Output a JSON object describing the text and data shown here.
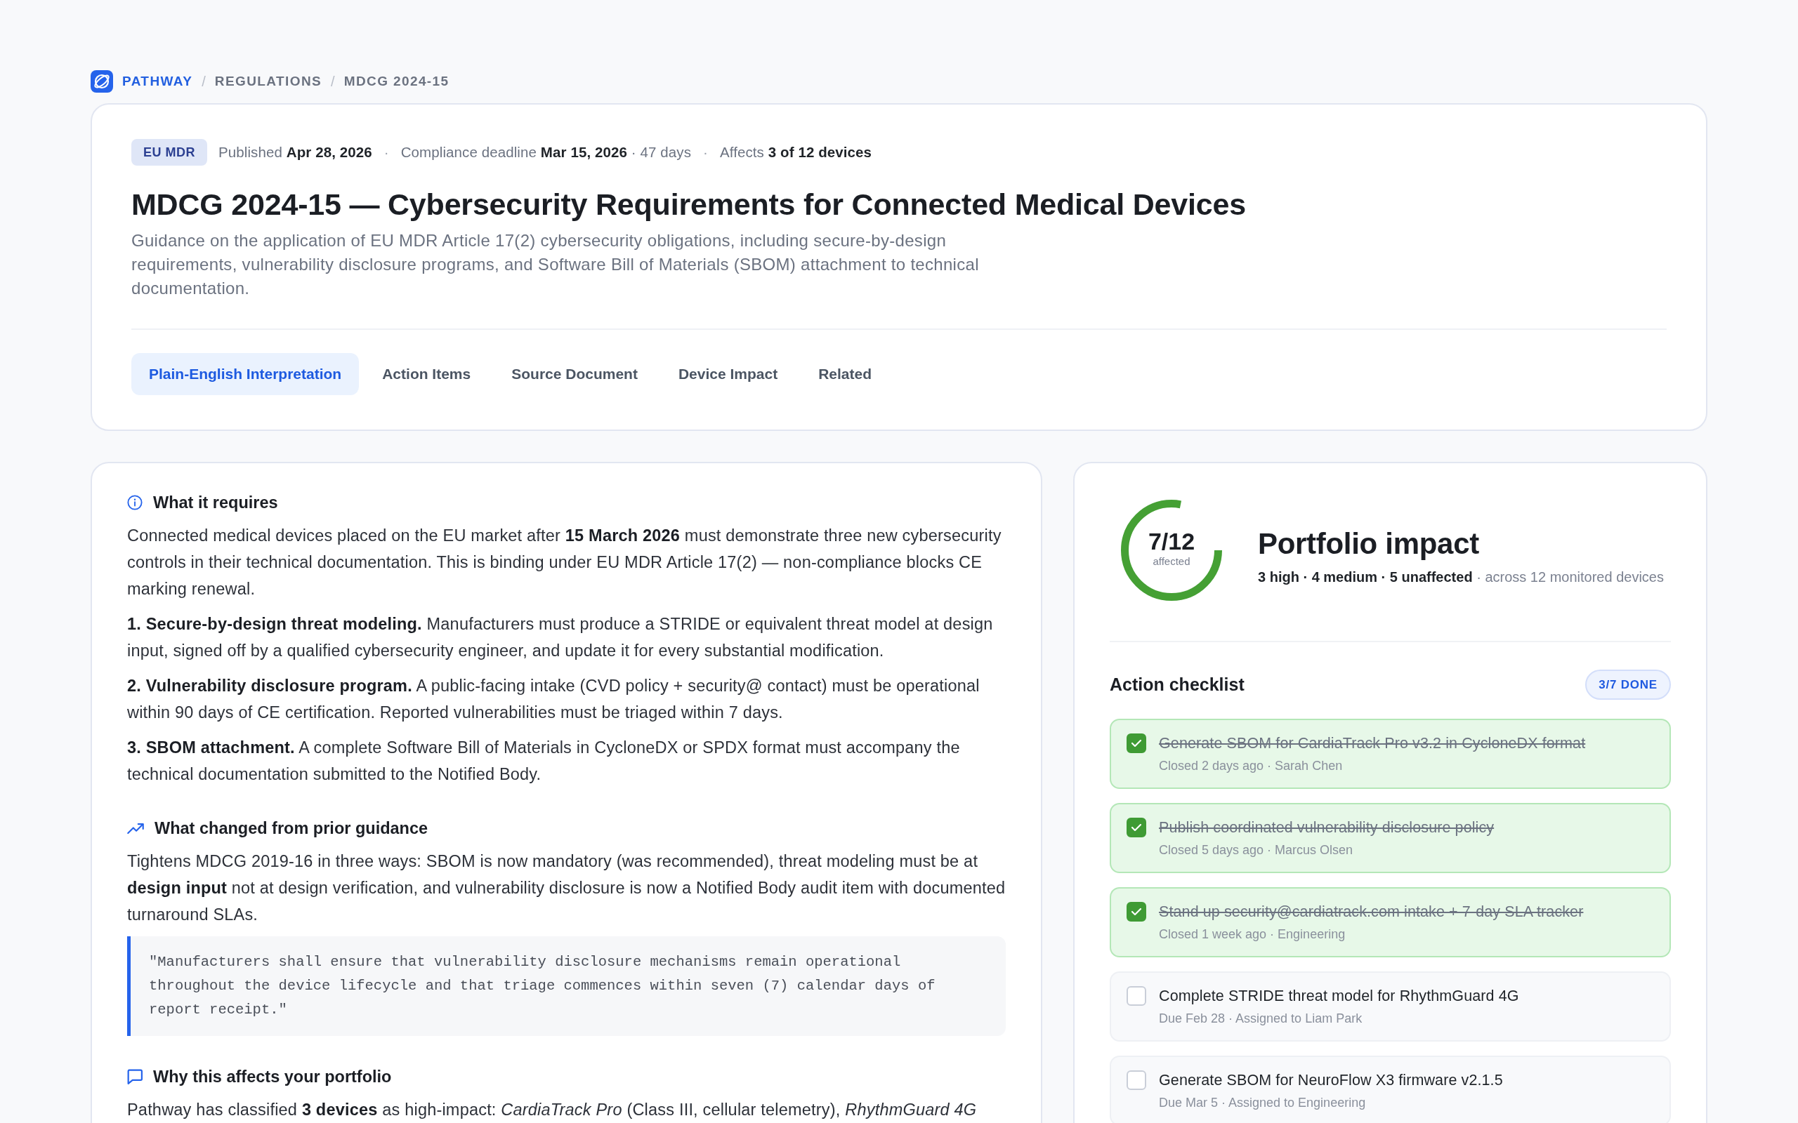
{
  "breadcrumb": {
    "separator": "/",
    "items": [
      {
        "label": "PATHWAY",
        "kind": "brand"
      },
      {
        "label": "REGULATIONS",
        "kind": "link"
      },
      {
        "label": "MDCG 2024-15",
        "kind": "current"
      }
    ]
  },
  "header": {
    "badge": "EU MDR",
    "meta_separator": "·",
    "meta": [
      "Published **Apr 28, 2026**",
      "Compliance deadline **Mar 15, 2026** · 47 days",
      "Affects **3 of 12 devices**"
    ],
    "title": "MDCG 2024-15 — Cybersecurity Requirements for Connected Medical Devices",
    "description": "Guidance on the application of EU MDR Article 17(2) cybersecurity obligations, including secure-by-design requirements, vulnerability disclosure programs, and Software Bill of Materials (SBOM) attachment to technical documentation.",
    "tabs": [
      {
        "label": "Plain-English Interpretation",
        "selected": true
      },
      {
        "label": "Action Items",
        "selected": false
      },
      {
        "label": "Source Document",
        "selected": false
      },
      {
        "label": "Device Impact",
        "selected": false
      },
      {
        "label": "Related",
        "selected": false
      }
    ]
  },
  "interpretation": {
    "sections": [
      {
        "heading": "What it requires",
        "blocks": [
          {
            "kind": "text",
            "text": "Connected medical devices placed on the EU market after **15 March 2026** must demonstrate three new cybersecurity controls in their technical documentation. This is binding under EU MDR Article 17(2) — non-compliance blocks CE marking renewal."
          },
          {
            "kind": "text",
            "text": "**1. Secure-by-design threat modeling.** Manufacturers must produce a STRIDE or equivalent threat model at design input, signed off by a qualified cybersecurity engineer, and update it for every substantial modification."
          },
          {
            "kind": "text",
            "text": "**2. Vulnerability disclosure program.** A public-facing intake (CVD policy + security@ contact) must be operational within 90 days of CE certification. Reported vulnerabilities must be triaged within 7 days."
          },
          {
            "kind": "text",
            "text": "**3. SBOM attachment.** A complete Software Bill of Materials in CycloneDX or SPDX format must accompany the technical documentation submitted to the Notified Body."
          }
        ]
      },
      {
        "heading": "What changed from prior guidance",
        "blocks": [
          {
            "kind": "text",
            "text": "Tightens MDCG 2019-16 in three ways: SBOM is now mandatory (was recommended), threat modeling must be at **design input** not at design verification, and vulnerability disclosure is now a Notified Body audit item with documented turnaround SLAs."
          },
          {
            "kind": "quote",
            "text": "\"Manufacturers shall ensure that vulnerability disclosure mechanisms remain operational throughout the device lifecycle and that triage commences within seven (7) calendar days of report receipt.\""
          }
        ]
      },
      {
        "heading": "Why this affects your portfolio",
        "blocks": [
          {
            "kind": "text",
            "text": "Pathway has classified **3 devices** as high-impact: *CardiaTrack Pro* (Class III, cellular telemetry), *RhythmGuard 4G*"
          }
        ]
      }
    ]
  },
  "portfolio": {
    "ring": {
      "value": "7/12",
      "label": "affected",
      "level": 0.78
    },
    "title": "Portfolio impact",
    "summary": "**3 high · 4 medium · 5 unaffected** · across 12 monitored devices"
  },
  "checklist": {
    "title": "Action checklist",
    "badge": "3/7 DONE",
    "items": [
      {
        "title": "Generate SBOM for CardiaTrack Pro v3.2 in CycloneDX format",
        "meta": "Closed 2 days ago · Sarah Chen",
        "checked": true
      },
      {
        "title": "Publish coordinated vulnerability disclosure policy",
        "meta": "Closed 5 days ago · Marcus Olsen",
        "checked": true
      },
      {
        "title": "Stand up security@cardiatrack.com intake + 7-day SLA tracker",
        "meta": "Closed 1 week ago · Engineering",
        "checked": true
      },
      {
        "title": "Complete STRIDE threat model for RhythmGuard 4G",
        "meta": "Due Feb 28 · Assigned to Liam Park",
        "checked": false
      },
      {
        "title": "Generate SBOM for NeuroFlow X3 firmware v2.1.5",
        "meta": "Due Mar 5 · Assigned to Engineering",
        "checked": false
      }
    ]
  }
}
